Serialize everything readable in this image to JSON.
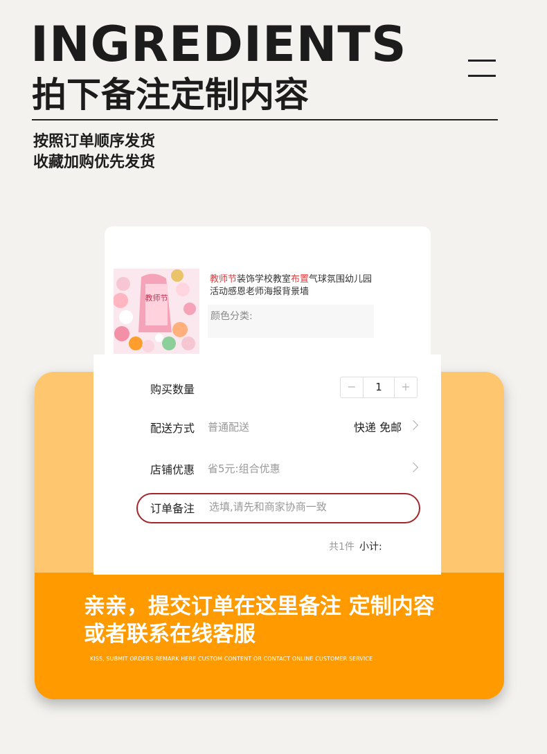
{
  "header": {
    "title": "INGREDIENTS",
    "subtitle": "拍下备注定制内容",
    "note_lines": [
      "按照订单顺序发货",
      "收藏加购优先发货"
    ]
  },
  "product": {
    "title_parts": [
      {
        "text": "教师节",
        "highlight": true
      },
      {
        "text": "装饰学校教室",
        "highlight": false
      },
      {
        "text": "布置",
        "highlight": true
      },
      {
        "text": "气球氛围幼儿园活动感恩老师海报背景墙",
        "highlight": false
      }
    ],
    "variant_label": "颜色分类:"
  },
  "order": {
    "quantity_label": "购买数量",
    "quantity": "1",
    "minus": "−",
    "plus": "+",
    "shipping_label": "配送方式",
    "shipping_value": "普通配送",
    "shipping_right": "快递 免邮",
    "coupon_label": "店铺优惠",
    "coupon_value": "省5元:组合优惠",
    "remark_label": "订单备注",
    "remark_placeholder": "选填,请先和商家协商一致",
    "total_count": "共1件",
    "subtotal_label": "小计:"
  },
  "banner": {
    "line1": "亲亲，提交订单在这里备注 定制内容",
    "line2": "或者联系在线客服",
    "english": "KISS, SUBMIT ORDERS REMARK HERE CUSTOM CONTENT OR CONTACT ONLINE CUSTOMER SERVICE"
  },
  "colors": {
    "highlight": "#e4393c",
    "remark_ring": "#a2262a",
    "panel_light": "#ffc670",
    "panel_dark": "#ff9a00"
  },
  "icons": [
    "menu-icon",
    "chevron-right-icon"
  ]
}
